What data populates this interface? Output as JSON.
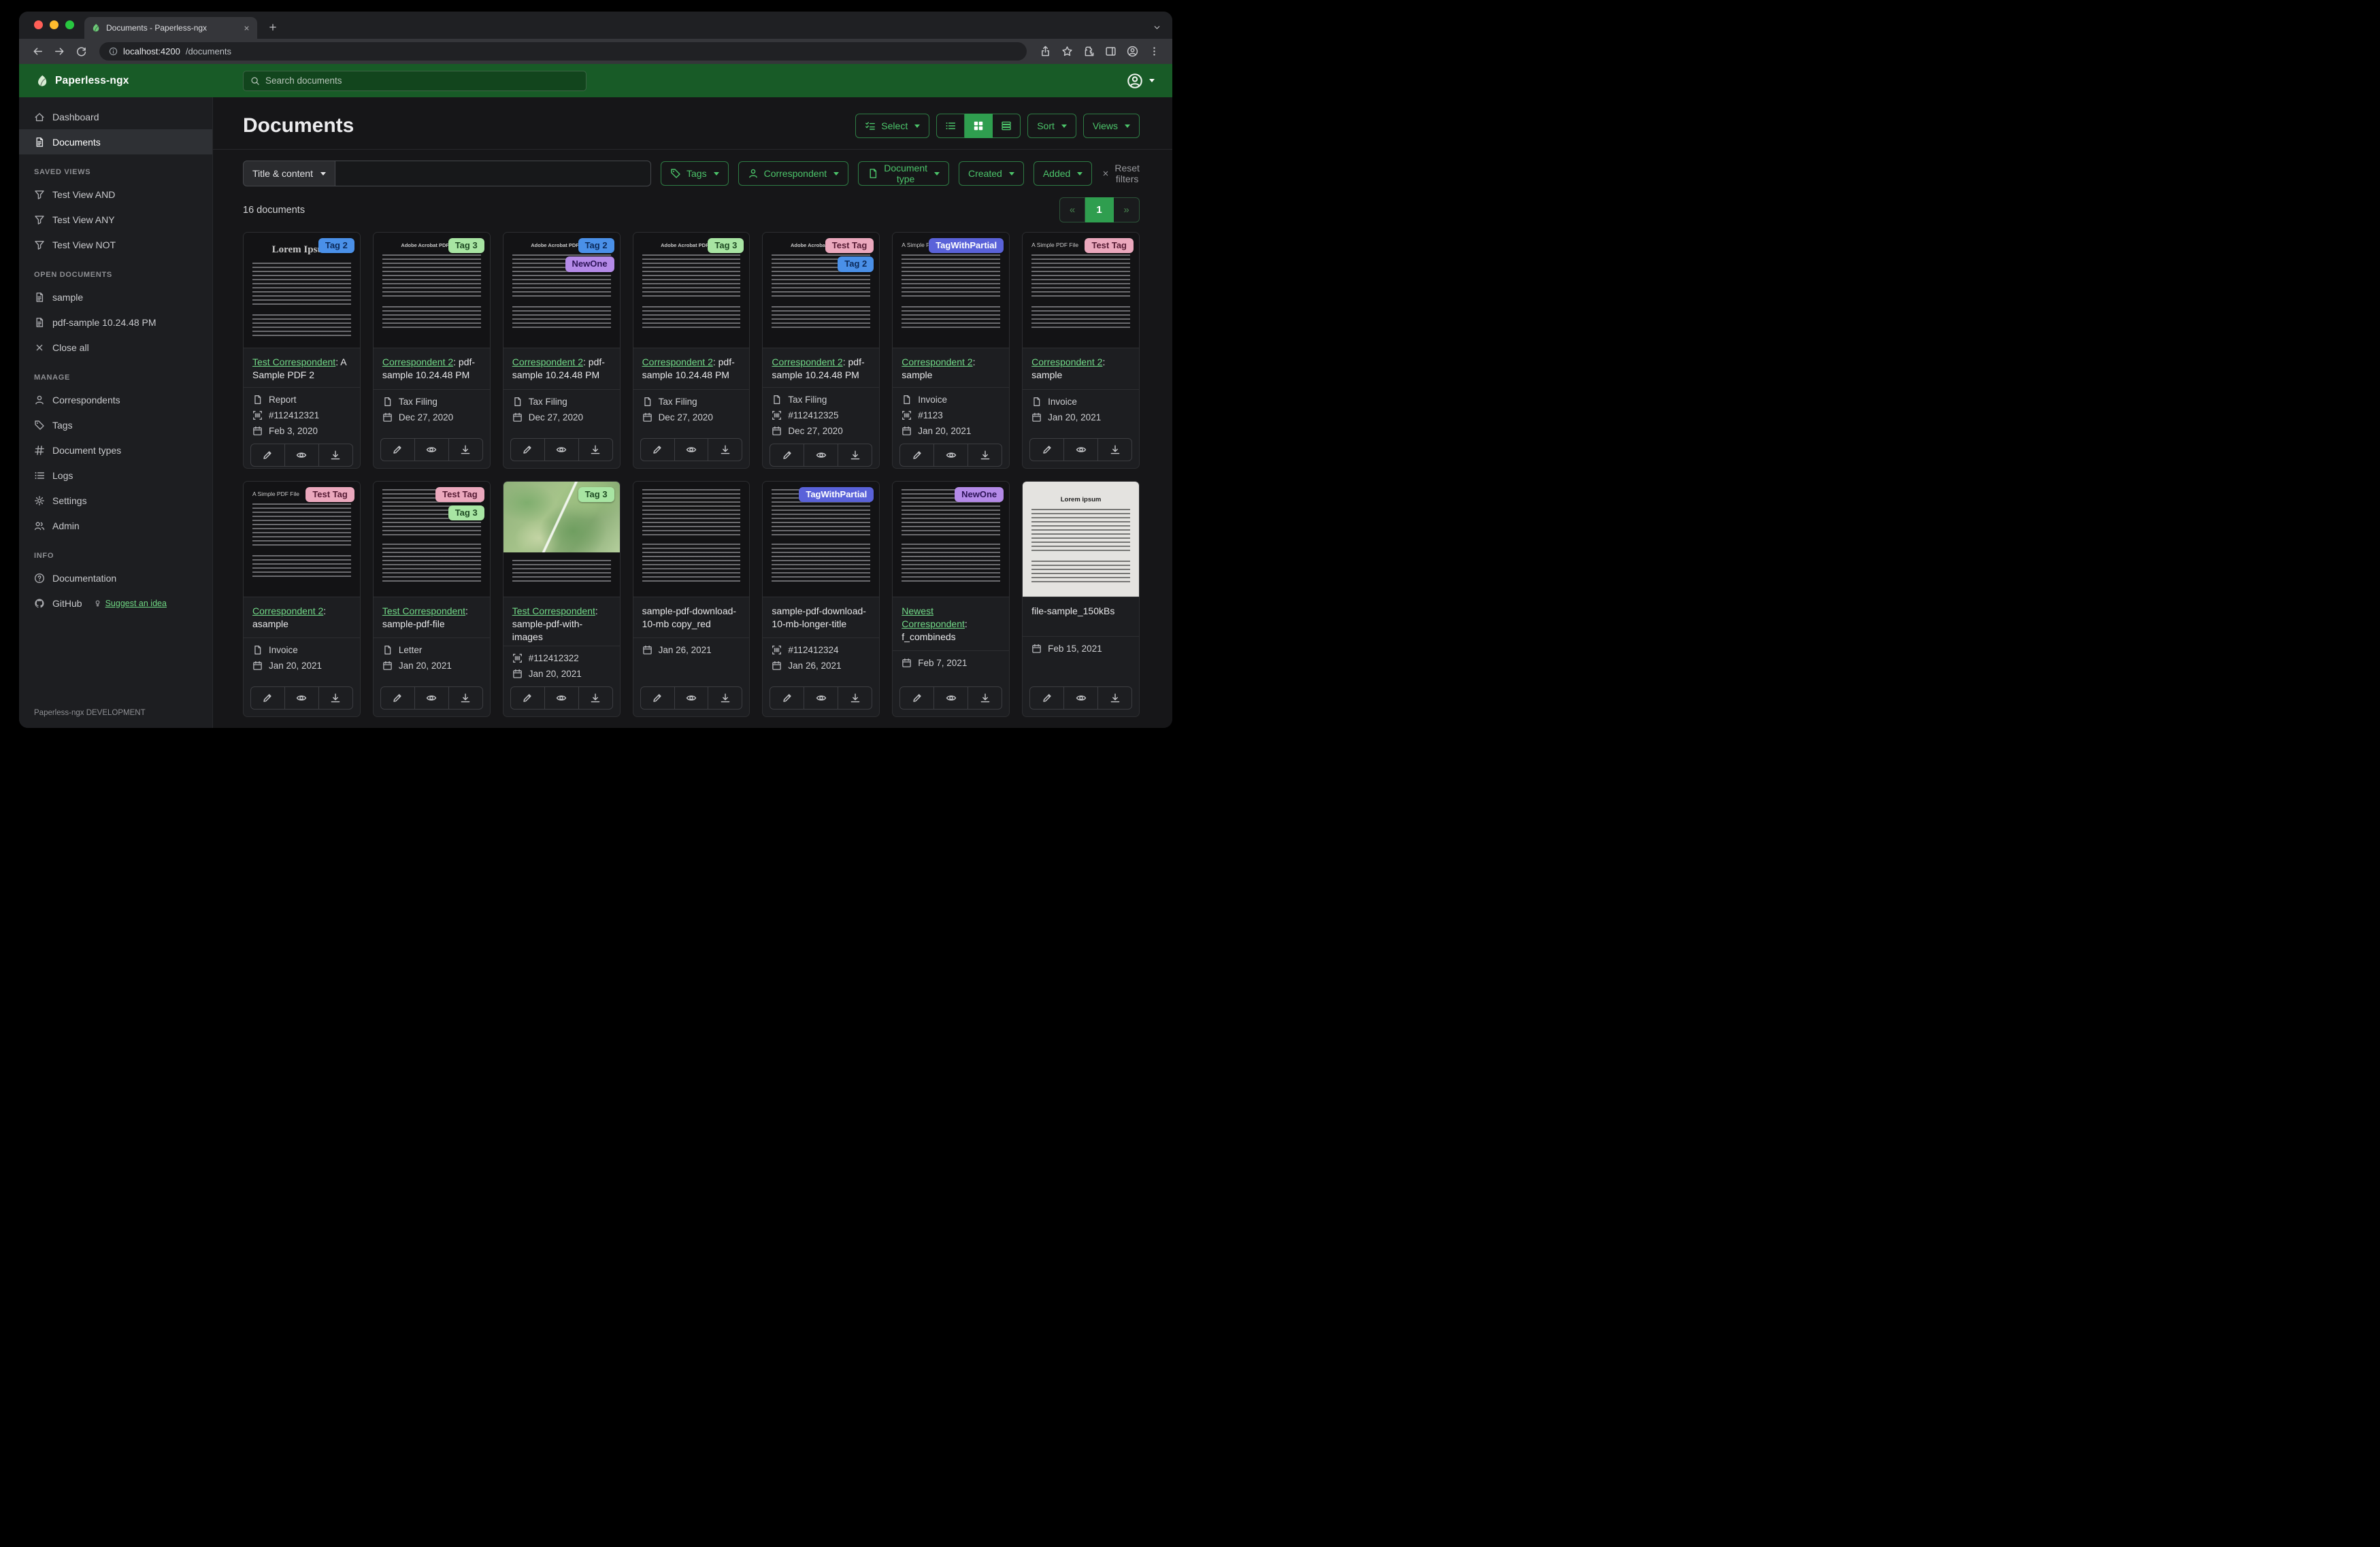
{
  "browser": {
    "tab_title": "Documents - Paperless-ngx",
    "url_host": "localhost:4200",
    "url_path": "/documents"
  },
  "app_header": {
    "brand": "Paperless-ngx",
    "search_placeholder": "Search documents"
  },
  "sidebar": {
    "primary": [
      {
        "label": "Dashboard",
        "icon": "house",
        "active": false
      },
      {
        "label": "Documents",
        "icon": "filetext",
        "active": true
      }
    ],
    "sections": [
      {
        "title": "SAVED VIEWS",
        "items": [
          {
            "label": "Test View AND",
            "icon": "funnel"
          },
          {
            "label": "Test View ANY",
            "icon": "funnel"
          },
          {
            "label": "Test View NOT",
            "icon": "funnel"
          }
        ]
      },
      {
        "title": "OPEN DOCUMENTS",
        "items": [
          {
            "label": "sample",
            "icon": "filetext"
          },
          {
            "label": "pdf-sample 10.24.48 PM",
            "icon": "filetext"
          },
          {
            "label": "Close all",
            "icon": "close"
          }
        ]
      },
      {
        "title": "MANAGE",
        "items": [
          {
            "label": "Correspondents",
            "icon": "person"
          },
          {
            "label": "Tags",
            "icon": "tag"
          },
          {
            "label": "Document types",
            "icon": "hash"
          },
          {
            "label": "Logs",
            "icon": "listul"
          },
          {
            "label": "Settings",
            "icon": "gear"
          },
          {
            "label": "Admin",
            "icon": "people"
          }
        ]
      },
      {
        "title": "INFO",
        "items": [
          {
            "label": "Documentation",
            "icon": "question"
          }
        ]
      }
    ],
    "github_label": "GitHub",
    "suggest_label": "Suggest an idea",
    "footer": "Paperless-ngx DEVELOPMENT"
  },
  "toolbar": {
    "title": "Documents",
    "select_label": "Select",
    "sort_label": "Sort",
    "views_label": "Views",
    "view_toggles": [
      {
        "name": "list-view",
        "icon": "listul",
        "active": false
      },
      {
        "name": "grid-view",
        "icon": "grid",
        "active": true
      },
      {
        "name": "detail-view",
        "icon": "rows",
        "active": false
      }
    ]
  },
  "filters": {
    "title_dropdown_label": "Title & content",
    "query_value": "",
    "buttons": [
      {
        "label": "Tags",
        "icon": "tag"
      },
      {
        "label": "Correspondent",
        "icon": "person"
      },
      {
        "label": "Document type",
        "icon": "file"
      },
      {
        "label": "Created",
        "icon": null
      },
      {
        "label": "Added",
        "icon": null
      }
    ],
    "reset_label": "Reset filters"
  },
  "results": {
    "count_label": "16 documents",
    "pager": {
      "prev": "«",
      "page": "1",
      "next": "»"
    }
  },
  "tag_palette": {
    "Tag 2": {
      "bg": "#4a90e8",
      "fg": "#0c2a5a"
    },
    "Tag 3": {
      "bg": "#a8e5a3",
      "fg": "#1e4a22"
    },
    "NewOne": {
      "bg": "#b48ae8",
      "fg": "#2c1457"
    },
    "Test Tag": {
      "bg": "#eba8bd",
      "fg": "#551a33"
    },
    "TagWithPartial": {
      "bg": "#5a62d9",
      "fg": "#ffffff"
    }
  },
  "card_actions": [
    {
      "name": "edit",
      "icon": "pencil"
    },
    {
      "name": "preview",
      "icon": "eye"
    },
    {
      "name": "download",
      "icon": "download"
    }
  ],
  "cards": [
    {
      "thumb": "lorem",
      "thumb_heading": "Lorem Ipsum",
      "tags": [
        "Tag 2"
      ],
      "correspondent": "Test Correspondent",
      "title_text": ": A Sample PDF 2",
      "doc_type": "Report",
      "asn": "#112412321",
      "date": "Feb 3, 2020"
    },
    {
      "thumb": "acrobat",
      "thumb_heading": "Adobe Acrobat PDF Files",
      "tags": [
        "Tag 3"
      ],
      "correspondent": "Correspondent 2",
      "title_text": ": pdf-sample 10.24.48 PM",
      "doc_type": "Tax Filing",
      "asn": null,
      "date": "Dec 27, 2020"
    },
    {
      "thumb": "acrobat",
      "thumb_heading": "Adobe Acrobat PDF Files",
      "tags": [
        "Tag 2",
        "NewOne"
      ],
      "correspondent": "Correspondent 2",
      "title_text": ": pdf-sample 10.24.48 PM",
      "doc_type": "Tax Filing",
      "asn": null,
      "date": "Dec 27, 2020"
    },
    {
      "thumb": "acrobat",
      "thumb_heading": "Adobe Acrobat PDF Files",
      "tags": [
        "Tag 3"
      ],
      "correspondent": "Correspondent 2",
      "title_text": ": pdf-sample 10.24.48 PM",
      "doc_type": "Tax Filing",
      "asn": null,
      "date": "Dec 27, 2020"
    },
    {
      "thumb": "acrobat",
      "thumb_heading": "Adobe Acrobat PDF Files",
      "tags": [
        "Test Tag",
        "Tag 2"
      ],
      "correspondent": "Correspondent 2",
      "title_text": ": pdf-sample 10.24.48 PM",
      "doc_type": "Tax Filing",
      "asn": "#112412325",
      "date": "Dec 27, 2020"
    },
    {
      "thumb": "simple",
      "thumb_heading": "A Simple PDF File",
      "tags": [
        "TagWithPartial"
      ],
      "correspondent": "Correspondent 2",
      "title_text": ": sample",
      "doc_type": "Invoice",
      "asn": "#1123",
      "date": "Jan 20, 2021"
    },
    {
      "thumb": "simple",
      "thumb_heading": "A Simple PDF File",
      "tags": [
        "Test Tag"
      ],
      "correspondent": "Correspondent 2",
      "title_text": ": sample",
      "doc_type": "Invoice",
      "asn": null,
      "date": "Jan 20, 2021"
    },
    {
      "thumb": "simple",
      "thumb_heading": "A Simple PDF File",
      "tags": [
        "Test Tag"
      ],
      "correspondent": "Correspondent 2",
      "title_text": ": asample",
      "doc_type": "Invoice",
      "asn": null,
      "date": "Jan 20, 2021"
    },
    {
      "thumb": "dense",
      "thumb_heading": "",
      "tags": [
        "Test Tag",
        "Tag 3"
      ],
      "correspondent": "Test Correspondent",
      "title_text": ": sample-pdf-file",
      "doc_type": "Letter",
      "asn": null,
      "date": "Jan 20, 2021"
    },
    {
      "thumb": "map",
      "thumb_heading": "",
      "tags": [
        "Tag 3"
      ],
      "correspondent": "Test Correspondent",
      "title_text": ": sample-pdf-with-images",
      "doc_type": null,
      "asn": "#112412322",
      "date": "Jan 20, 2021"
    },
    {
      "thumb": "dense",
      "thumb_heading": "",
      "tags": [],
      "correspondent": null,
      "title_text": "sample-pdf-download-10-mb copy_red",
      "doc_type": null,
      "asn": null,
      "date": "Jan 26, 2021"
    },
    {
      "thumb": "dense",
      "thumb_heading": "",
      "tags": [
        "TagWithPartial"
      ],
      "correspondent": null,
      "title_text": "sample-pdf-download-10-mb-longer-title",
      "doc_type": null,
      "asn": "#112412324",
      "date": "Jan 26, 2021"
    },
    {
      "thumb": "dense",
      "thumb_heading": "",
      "tags": [
        "NewOne"
      ],
      "correspondent": "Newest Correspondent",
      "title_text": ": f_combineds",
      "doc_type": null,
      "asn": null,
      "date": "Feb 7, 2021"
    },
    {
      "thumb": "light",
      "thumb_heading": "Lorem ipsum",
      "tags": [],
      "correspondent": null,
      "title_text": "file-sample_150kBs",
      "doc_type": null,
      "asn": null,
      "date": "Feb 15, 2021"
    }
  ]
}
